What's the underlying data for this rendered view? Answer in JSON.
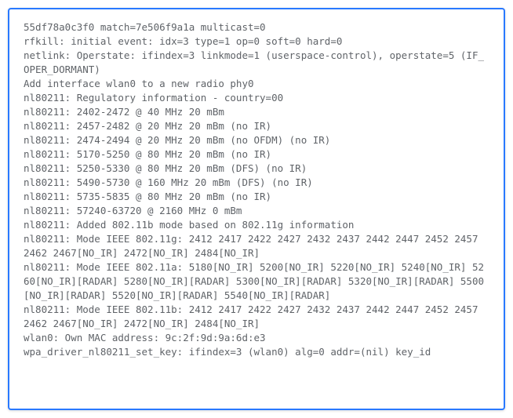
{
  "terminal": {
    "log": "55df78a0c3f0 match=7e506f9a1a multicast=0\nrfkill: initial event: idx=3 type=1 op=0 soft=0 hard=0\nnetlink: Operstate: ifindex=3 linkmode=1 (userspace-control), operstate=5 (IF_OPER_DORMANT)\nAdd interface wlan0 to a new radio phy0\nnl80211: Regulatory information - country=00\nnl80211: 2402-2472 @ 40 MHz 20 mBm\nnl80211: 2457-2482 @ 20 MHz 20 mBm (no IR)\nnl80211: 2474-2494 @ 20 MHz 20 mBm (no OFDM) (no IR)\nnl80211: 5170-5250 @ 80 MHz 20 mBm (no IR)\nnl80211: 5250-5330 @ 80 MHz 20 mBm (DFS) (no IR)\nnl80211: 5490-5730 @ 160 MHz 20 mBm (DFS) (no IR)\nnl80211: 5735-5835 @ 80 MHz 20 mBm (no IR)\nnl80211: 57240-63720 @ 2160 MHz 0 mBm\nnl80211: Added 802.11b mode based on 802.11g information\nnl80211: Mode IEEE 802.11g: 2412 2417 2422 2427 2432 2437 2442 2447 2452 2457 2462 2467[NO_IR] 2472[NO_IR] 2484[NO_IR]\nnl80211: Mode IEEE 802.11a: 5180[NO_IR] 5200[NO_IR] 5220[NO_IR] 5240[NO_IR] 5260[NO_IR][RADAR] 5280[NO_IR][RADAR] 5300[NO_IR][RADAR] 5320[NO_IR][RADAR] 5500[NO_IR][RADAR] 5520[NO_IR][RADAR] 5540[NO_IR][RADAR]\nnl80211: Mode IEEE 802.11b: 2412 2417 2422 2427 2432 2437 2442 2447 2452 2457 2462 2467[NO_IR] 2472[NO_IR] 2484[NO_IR]\nwlan0: Own MAC address: 9c:2f:9d:9a:6d:e3\nwpa_driver_nl80211_set_key: ifindex=3 (wlan0) alg=0 addr=(nil) key_id"
  }
}
